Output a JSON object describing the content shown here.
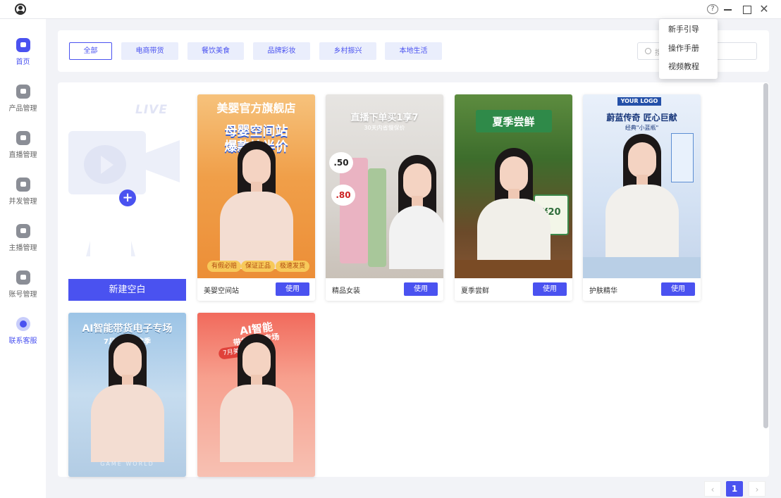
{
  "window": {
    "app_icon": "user-circle-icon",
    "help_icon_glyph": "?",
    "close_glyph": "✕"
  },
  "sidebar": {
    "items": [
      {
        "label": "首页",
        "icon": "home-icon",
        "active": true
      },
      {
        "label": "产品管理",
        "icon": "product-icon"
      },
      {
        "label": "直播管理",
        "icon": "live-icon"
      },
      {
        "label": "并发管理",
        "icon": "concurrency-icon"
      },
      {
        "label": "主播管理",
        "icon": "anchor-icon"
      },
      {
        "label": "账号管理",
        "icon": "account-icon"
      },
      {
        "label": "联系客服",
        "icon": "customer-service-icon"
      }
    ]
  },
  "filters": {
    "chips": [
      {
        "label": "全部",
        "active": true
      },
      {
        "label": "电商带货"
      },
      {
        "label": "餐饮美食"
      },
      {
        "label": "品牌彩妆"
      },
      {
        "label": "乡村振兴"
      },
      {
        "label": "本地生活"
      }
    ],
    "search_placeholder": "搜"
  },
  "new_blank": {
    "watermark": "LIVE",
    "plus_glyph": "+",
    "button_label": "新建空白"
  },
  "templates": [
    {
      "name": "美婴空间站",
      "use_label": "使用",
      "headline": "美婴官方旗舰店",
      "banner_line1": "母婴空间站",
      "banner_line2": "爆款抢半价",
      "tags": [
        "有假必赔",
        "保证正品",
        "极速发货"
      ]
    },
    {
      "name": "精品女装",
      "use_label": "使用",
      "headline": "直播下单买1享7",
      "subline": "30天内省慢保价",
      "price_tags": [
        ".50",
        ".80"
      ]
    },
    {
      "name": "夏季尝鲜",
      "use_label": "使用",
      "headline": "夏季尝鲜",
      "price_label": "¥20"
    },
    {
      "name": "护肤精华",
      "use_label": "使用",
      "logo_text": "YOUR LOGO",
      "headline": "蔚蓝传奇 匠心巨献",
      "subline": "经典\"小蓝瓶\""
    },
    {
      "name": "",
      "headline": "AI智能带货电子专场",
      "subline": "7月限时狂欢季",
      "footer_text": "GAME WORLD"
    },
    {
      "name": "",
      "headline": "AI智能",
      "subline": "带货美妆专场",
      "ribbon": "7月美妆小课堂"
    }
  ],
  "pagination": {
    "prev": "‹",
    "current": "1",
    "next": "›"
  },
  "help_menu": {
    "items": [
      "新手引导",
      "操作手册",
      "视频教程"
    ]
  },
  "colors": {
    "accent": "#4a52f0",
    "chip_bg": "#eaeefc",
    "page_bg": "#f2f3f7"
  }
}
